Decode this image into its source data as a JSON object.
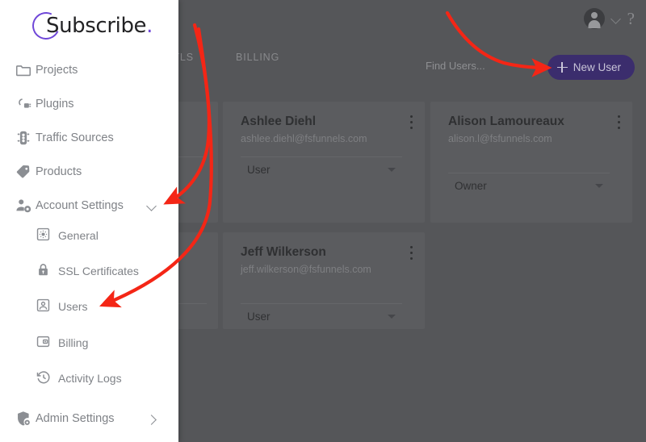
{
  "brand": {
    "name": "Subscribe",
    "dot": ".",
    "accent_color": "#6f47d8",
    "logo_icon": "circle-ring-logo"
  },
  "sidebar": {
    "items": [
      {
        "label": "Projects",
        "icon": "folder-icon",
        "level": "top",
        "chevron": ""
      },
      {
        "label": "Plugins",
        "icon": "plug-icon",
        "level": "top",
        "chevron": ""
      },
      {
        "label": "Traffic Sources",
        "icon": "traffic-light-icon",
        "level": "top",
        "chevron": ""
      },
      {
        "label": "Products",
        "icon": "tag-icon",
        "level": "top",
        "chevron": ""
      },
      {
        "label": "Account Settings",
        "icon": "person-gear-icon",
        "level": "top",
        "chevron": "chevron-down-icon"
      },
      {
        "label": "General",
        "icon": "gear-square-icon",
        "level": "sub",
        "chevron": ""
      },
      {
        "label": "SSL Certificates",
        "icon": "padlock-icon",
        "level": "sub",
        "chevron": ""
      },
      {
        "label": "Users",
        "icon": "account-box-icon",
        "level": "sub",
        "chevron": ""
      },
      {
        "label": "Billing",
        "icon": "wallet-square-icon",
        "level": "sub",
        "chevron": ""
      },
      {
        "label": "Activity Logs",
        "icon": "history-clock-icon",
        "level": "sub",
        "chevron": ""
      },
      {
        "label": "Admin Settings",
        "icon": "shield-gear-icon",
        "level": "top",
        "chevron": "chevron-right-icon"
      }
    ]
  },
  "topbar": {
    "avatar_icon": "account-circle-icon",
    "avatar_chevron_icon": "chevron-down-icon",
    "help_icon": "question-mark-icon",
    "help_label": "?"
  },
  "tabs": [
    {
      "label": "/TLS",
      "truncated": true
    },
    {
      "label": "BILLING",
      "truncated": false
    }
  ],
  "search": {
    "placeholder": "Find Users...",
    "value": "Find Users..."
  },
  "new_user_button": {
    "label": "New User",
    "icon": "plus-icon",
    "background_color": "#3b2d6d"
  },
  "users": [
    {
      "name": "Ashlee Diehl",
      "email": "ashlee.diehl@fsfunnels.com",
      "role": "User",
      "role_caret_icon": "caret-down-icon",
      "menu_icon": "kebab-menu-icon"
    },
    {
      "name": "Alison Lamoureaux",
      "email": "alison.l@fsfunnels.com",
      "role": "Owner",
      "role_caret_icon": "caret-down-icon",
      "menu_icon": "kebab-menu-icon"
    },
    {
      "name": "Jeff Wilkerson",
      "email": "jeff.wilkerson@fsfunnels.com",
      "role": "User",
      "role_caret_icon": "caret-down-icon",
      "menu_icon": "kebab-menu-icon"
    }
  ],
  "annotations": {
    "color": "#f42616",
    "arrows": [
      {
        "name": "arrow-to-account-settings-chevron",
        "target": "Account Settings expand chevron"
      },
      {
        "name": "arrow-to-users-menu-item",
        "target": "Users"
      },
      {
        "name": "arrow-to-new-user-button",
        "target": "New User"
      }
    ]
  },
  "overlay": {
    "dim_color": "#555659",
    "card_color": "#5b5c5f"
  }
}
